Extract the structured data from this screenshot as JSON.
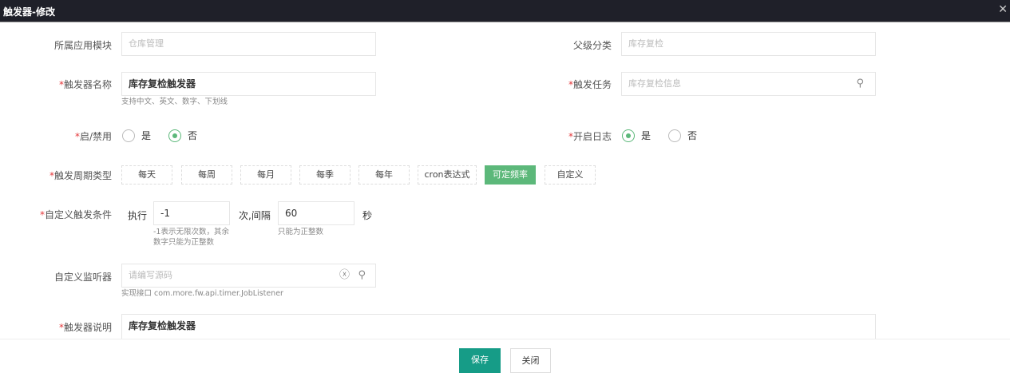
{
  "window": {
    "title": "触发器-修改",
    "close_icon": "close-icon"
  },
  "form": {
    "module": {
      "label": "所属应用模块",
      "placeholder": "仓库管理"
    },
    "parent": {
      "label": "父级分类",
      "placeholder": "库存复检"
    },
    "name": {
      "label": "触发器名称",
      "value": "库存复检触发器",
      "hint": "支持中文、英文、数字、下划线"
    },
    "task": {
      "label": "触发任务",
      "placeholder": "库存复检信息"
    },
    "enabled": {
      "label": "启/禁用",
      "options": [
        "是",
        "否"
      ],
      "selected": "否"
    },
    "log": {
      "label": "开启日志",
      "options": [
        "是",
        "否"
      ],
      "selected": "是"
    },
    "period": {
      "label": "触发周期类型",
      "options": [
        "每天",
        "每周",
        "每月",
        "每季",
        "每年",
        "cron表达式",
        "可定频率",
        "自定义"
      ],
      "selected": "可定频率"
    },
    "condition": {
      "label": "自定义触发条件",
      "prefix": "执行",
      "count": "-1",
      "middle": "次,间隔",
      "interval": "60",
      "suffix": "秒",
      "count_hint": "-1表示无限次数，其余数字只能为正整数",
      "interval_hint": "只能为正整数"
    },
    "listener": {
      "label": "自定义监听器",
      "placeholder": "请编写源码",
      "hint": "实现接口 com.more.fw.api.timer.JobListener"
    },
    "desc": {
      "label": "触发器说明",
      "value": "库存复检触发器"
    },
    "required_mark": "*"
  },
  "footer": {
    "save": "保存",
    "close": "关闭"
  },
  "colors": {
    "header": "#1f2029",
    "selected": "#5cb87a",
    "save": "#169c87",
    "required": "#e4393c"
  }
}
